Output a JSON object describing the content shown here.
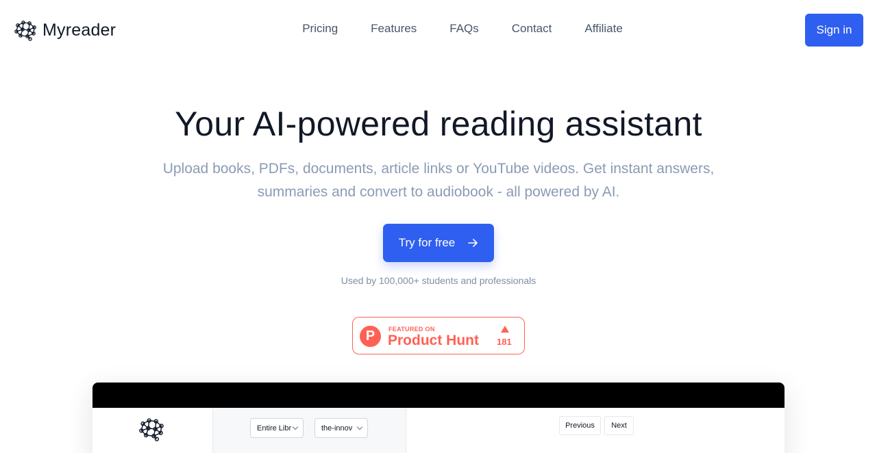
{
  "brand": {
    "name": "Myreader",
    "logo_icon": "brain-network-icon"
  },
  "nav": {
    "items": [
      {
        "label": "Pricing"
      },
      {
        "label": "Features"
      },
      {
        "label": "FAQs"
      },
      {
        "label": "Contact"
      },
      {
        "label": "Affiliate"
      }
    ],
    "signin_label": "Sign in"
  },
  "hero": {
    "title": "Your AI-powered reading assistant",
    "subtitle": "Upload books, PDFs, documents, article links or YouTube videos. Get instant answers, summaries and convert to audiobook - all powered by AI.",
    "cta_label": "Try for free",
    "cta_icon": "arrow-right-icon",
    "used_by": "Used by 100,000+ students and professionals"
  },
  "product_hunt": {
    "featured_label": "FEATURED ON",
    "name": "Product Hunt",
    "logo_letter": "P",
    "upvotes": "181",
    "color": "#ff6154"
  },
  "preview": {
    "library_select": "Entire Libr",
    "book_select": "the-innov",
    "prev_label": "Previous",
    "next_label": "Next"
  },
  "colors": {
    "accent": "#2f5ff0",
    "text": "#111827",
    "muted": "#8a9bb3"
  }
}
